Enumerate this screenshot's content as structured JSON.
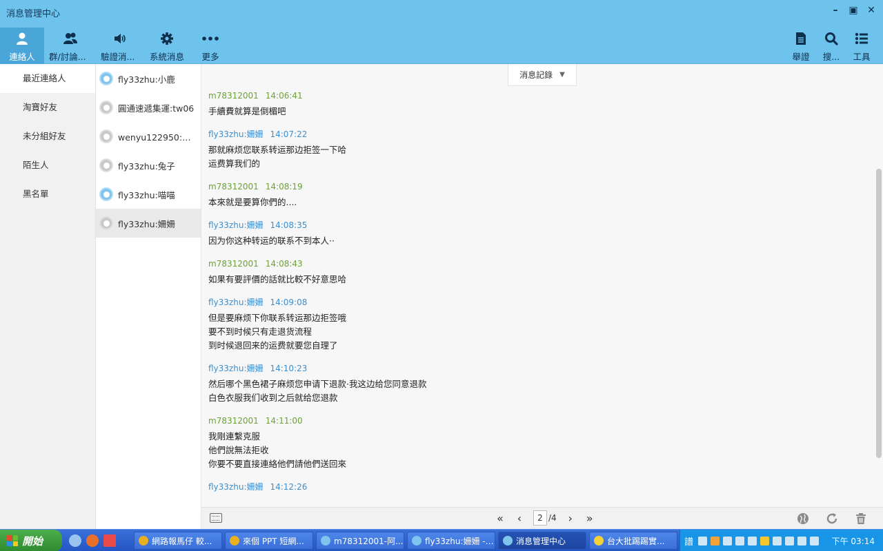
{
  "window": {
    "title": "消息管理中心"
  },
  "toolbar": {
    "left": [
      {
        "label": "連絡人",
        "icon": "person-icon",
        "active": true
      },
      {
        "label": "群/討論...",
        "icon": "group-icon"
      },
      {
        "label": "驗證消...",
        "icon": "speaker-icon"
      },
      {
        "label": "系統消息",
        "icon": "gear-icon"
      },
      {
        "label": "更多",
        "icon": "more-icon"
      }
    ],
    "right": [
      {
        "label": "舉證",
        "icon": "document-icon"
      },
      {
        "label": "搜...",
        "icon": "search-icon"
      },
      {
        "label": "工具",
        "icon": "list-icon"
      }
    ]
  },
  "categories": [
    {
      "label": "最近連絡人",
      "active": true
    },
    {
      "label": "淘寶好友"
    },
    {
      "label": "未分組好友"
    },
    {
      "label": "陌生人"
    },
    {
      "label": "黑名單"
    }
  ],
  "contacts": [
    {
      "name": "fly33zhu:小鹿",
      "status": "online"
    },
    {
      "name": "圓通速遞集運:tw06",
      "status": "offline"
    },
    {
      "name": "wenyu122950:乖...",
      "status": "offline"
    },
    {
      "name": "fly33zhu:兔子",
      "status": "offline"
    },
    {
      "name": "fly33zhu:喵喵",
      "status": "online"
    },
    {
      "name": "fly33zhu:姍姍",
      "status": "offline",
      "active": true
    }
  ],
  "history_dropdown": {
    "label": "消息記錄"
  },
  "messages": [
    {
      "sender": "m78312001",
      "time": "14:06:41",
      "self": true,
      "lines": [
        "手續費就算是倒楣吧"
      ]
    },
    {
      "sender": "fly33zhu:姍姍",
      "time": "14:07:22",
      "self": false,
      "lines": [
        "那就麻烦您联系转运那边拒签一下哈",
        "运费算我们的"
      ]
    },
    {
      "sender": "m78312001",
      "time": "14:08:19",
      "self": true,
      "lines": [
        "本來就是要算你們的...."
      ]
    },
    {
      "sender": "fly33zhu:姍姍",
      "time": "14:08:35",
      "self": false,
      "lines": [
        "因为你这种转运的联系不到本人··"
      ]
    },
    {
      "sender": "m78312001",
      "time": "14:08:43",
      "self": true,
      "lines": [
        "如果有要評價的話就比較不好意思哈"
      ]
    },
    {
      "sender": "fly33zhu:姍姍",
      "time": "14:09:08",
      "self": false,
      "lines": [
        "但是要麻烦下你联系转运那边拒签哦",
        "要不到时候只有走退货流程",
        "到时候退回来的运费就要您自理了"
      ]
    },
    {
      "sender": "fly33zhu:姍姍",
      "time": "14:10:23",
      "self": false,
      "lines": [
        "然后哪个黑色裙子麻烦您申请下退款·我这边给您同意退款",
        "白色衣服我们收到之后就给您退款"
      ]
    },
    {
      "sender": "m78312001",
      "time": "14:11:00",
      "self": true,
      "lines": [
        "我剛連繫克服",
        "他們說無法拒收",
        "你要不要直接連絡他們請他們送回來"
      ]
    },
    {
      "sender": "fly33zhu:姍姍",
      "time": "14:12:26",
      "self": false,
      "lines": []
    }
  ],
  "pager": {
    "current": "2",
    "total": "/4"
  },
  "taskbar": {
    "start_label": "開始",
    "tasks": [
      {
        "label": "網路報馬仔 較...",
        "color": "#e8b020"
      },
      {
        "label": "來個 PPT 短網...",
        "color": "#e8b020"
      },
      {
        "label": "m78312001-阿...",
        "color": "#7fc4ee"
      },
      {
        "label": "fly33zhu:姍姍 - ...",
        "color": "#7fc4ee"
      },
      {
        "label": "消息管理中心",
        "color": "#7fc4ee",
        "active": true
      },
      {
        "label": "台大批踢踢實...",
        "color": "#f4d03a"
      }
    ],
    "ime": "譜",
    "clock": "下午 03:14"
  },
  "colors": {
    "accent": "#6ec3ec",
    "self_name": "#6aa332",
    "other_name": "#3b8fcf"
  }
}
